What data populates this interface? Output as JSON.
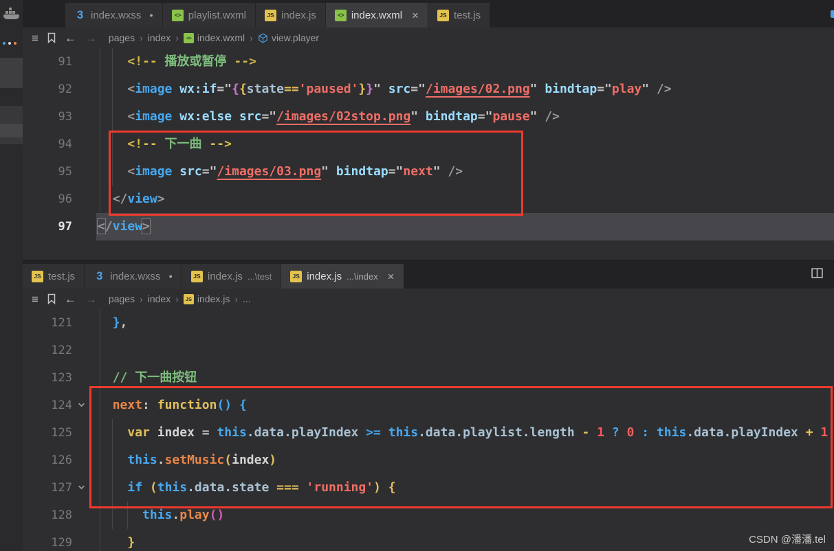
{
  "watermark": "CSDN @潘潘.tel",
  "activity_bar": {
    "icons": [
      "docker-whale-icon",
      "activity-dots"
    ]
  },
  "breadcrumb_lead_icons": [
    "list-icon",
    "bookmark-icon",
    "back-arrow-icon",
    "forward-arrow-icon"
  ],
  "panes": [
    {
      "id": "top",
      "tabs": [
        {
          "label": "index.wxss",
          "icon": "css",
          "modified": true
        },
        {
          "label": "playlist.wxml",
          "icon": "wxml"
        },
        {
          "label": "index.js",
          "icon": "js"
        },
        {
          "label": "index.wxml",
          "icon": "wxml",
          "active": true,
          "close": "×"
        },
        {
          "label": "test.js",
          "icon": "js"
        }
      ],
      "actions": [],
      "breadcrumbs": [
        {
          "label": "pages"
        },
        {
          "label": "index"
        },
        {
          "label": "index.wxml",
          "icon": "wxml"
        },
        {
          "label": "view.player",
          "icon": "symbol"
        }
      ],
      "lines": [
        {
          "num": "91",
          "tokens": [
            [
              "    ",
              "q"
            ],
            [
              "<!--",
              "cp"
            ],
            [
              " 播放或暂停 ",
              "cm"
            ],
            [
              "-->",
              "cp"
            ]
          ]
        },
        {
          "num": "92",
          "tokens": [
            [
              "    ",
              "q"
            ],
            [
              "<",
              "pq"
            ],
            [
              "image",
              "tag"
            ],
            [
              " ",
              "q"
            ],
            [
              "wx:if",
              "attr"
            ],
            [
              "=\"",
              "q"
            ],
            [
              "{",
              "mus"
            ],
            [
              "{",
              "op"
            ],
            [
              "state",
              "prop"
            ],
            [
              "==",
              "op"
            ],
            [
              "'paused'",
              "str"
            ],
            [
              "}",
              "op"
            ],
            [
              "}",
              "mus"
            ],
            [
              "\" ",
              "q"
            ],
            [
              "src",
              "attr"
            ],
            [
              "=\"",
              "q"
            ],
            [
              "/images/02.png",
              "lnk"
            ],
            [
              "\" ",
              "q"
            ],
            [
              "bindtap",
              "attr"
            ],
            [
              "=\"",
              "q"
            ],
            [
              "play",
              "str"
            ],
            [
              "\" ",
              "q"
            ],
            [
              "/>",
              "pq"
            ]
          ]
        },
        {
          "num": "93",
          "tokens": [
            [
              "    ",
              "q"
            ],
            [
              "<",
              "pq"
            ],
            [
              "image",
              "tag"
            ],
            [
              " ",
              "q"
            ],
            [
              "wx:else",
              "attr"
            ],
            [
              " ",
              "q"
            ],
            [
              "src",
              "attr"
            ],
            [
              "=\"",
              "q"
            ],
            [
              "/images/02stop.png",
              "lnk"
            ],
            [
              "\" ",
              "q"
            ],
            [
              "bindtap",
              "attr"
            ],
            [
              "=\"",
              "q"
            ],
            [
              "pause",
              "str"
            ],
            [
              "\" ",
              "q"
            ],
            [
              "/>",
              "pq"
            ]
          ]
        },
        {
          "num": "94",
          "tokens": [
            [
              "    ",
              "q"
            ],
            [
              "<!--",
              "cp"
            ],
            [
              " 下一曲 ",
              "cm"
            ],
            [
              "-->",
              "cp"
            ]
          ]
        },
        {
          "num": "95",
          "tokens": [
            [
              "    ",
              "q"
            ],
            [
              "<",
              "pq"
            ],
            [
              "image",
              "tag"
            ],
            [
              " ",
              "q"
            ],
            [
              "src",
              "attr"
            ],
            [
              "=\"",
              "q"
            ],
            [
              "/images/03.png",
              "lnk"
            ],
            [
              "\" ",
              "q"
            ],
            [
              "bindtap",
              "attr"
            ],
            [
              "=\"",
              "q"
            ],
            [
              "next",
              "str"
            ],
            [
              "\" ",
              "q"
            ],
            [
              "/>",
              "pq"
            ]
          ]
        },
        {
          "num": "96",
          "tokens": [
            [
              "  ",
              "q"
            ],
            [
              "</",
              "pq"
            ],
            [
              "view",
              "tag"
            ],
            [
              ">",
              "pq"
            ]
          ]
        },
        {
          "num": "97",
          "current": true,
          "tokens": [
            [
              "<",
              "pq bm"
            ],
            [
              "/",
              "pq"
            ],
            [
              "view",
              "tag"
            ],
            [
              ">",
              "pq bm"
            ]
          ]
        }
      ]
    },
    {
      "id": "bottom",
      "tabs": [
        {
          "label": "test.js",
          "icon": "js"
        },
        {
          "label": "index.wxss",
          "icon": "css",
          "modified": true
        },
        {
          "label": "index.js",
          "icon": "js",
          "desc": "...\\test"
        },
        {
          "label": "index.js",
          "icon": "js",
          "desc": "...\\index",
          "active": true,
          "close": "×"
        }
      ],
      "actions": [
        "split-editor-icon"
      ],
      "breadcrumbs": [
        {
          "label": "pages"
        },
        {
          "label": "index"
        },
        {
          "label": "index.js",
          "icon": "js"
        },
        {
          "label": "..."
        }
      ],
      "lines": [
        {
          "num": "121",
          "tokens": [
            [
              "  ",
              "q"
            ],
            [
              "}",
              "b1"
            ],
            [
              ",",
              "q"
            ]
          ]
        },
        {
          "num": "122",
          "tokens": []
        },
        {
          "num": "123",
          "tokens": [
            [
              "  ",
              "q"
            ],
            [
              "// 下一曲按钮",
              "cm"
            ]
          ]
        },
        {
          "num": "124",
          "fold": true,
          "tokens": [
            [
              "  ",
              "q"
            ],
            [
              "next",
              "fn"
            ],
            [
              ":",
              "q"
            ],
            [
              " ",
              "q"
            ],
            [
              "function",
              "kw"
            ],
            [
              "(",
              "b1"
            ],
            [
              ")",
              "b1"
            ],
            [
              " ",
              "q"
            ],
            [
              "{",
              "b1"
            ]
          ]
        },
        {
          "num": "125",
          "tokens": [
            [
              "    ",
              "q"
            ],
            [
              "var",
              "kw"
            ],
            [
              " ",
              "q"
            ],
            [
              "index",
              "var"
            ],
            [
              " ",
              "q"
            ],
            [
              "=",
              "q"
            ],
            [
              " ",
              "q"
            ],
            [
              "this",
              "kwb"
            ],
            [
              ".data.playIndex",
              "prop"
            ],
            [
              " ",
              "q"
            ],
            [
              ">=",
              "opb"
            ],
            [
              " ",
              "q"
            ],
            [
              "this",
              "kwb"
            ],
            [
              ".data.playlist.length",
              "prop"
            ],
            [
              " ",
              "q"
            ],
            [
              "-",
              "op"
            ],
            [
              " ",
              "q"
            ],
            [
              "1",
              "num"
            ],
            [
              " ",
              "q"
            ],
            [
              "?",
              "opb"
            ],
            [
              " ",
              "q"
            ],
            [
              "0",
              "num"
            ],
            [
              " ",
              "q"
            ],
            [
              ":",
              "opb"
            ],
            [
              " ",
              "q"
            ],
            [
              "this",
              "kwb"
            ],
            [
              ".data.playIndex",
              "prop"
            ],
            [
              " ",
              "q"
            ],
            [
              "+",
              "op"
            ],
            [
              " ",
              "q"
            ],
            [
              "1",
              "num"
            ]
          ]
        },
        {
          "num": "126",
          "tokens": [
            [
              "    ",
              "q"
            ],
            [
              "this",
              "kwb"
            ],
            [
              ".",
              "q"
            ],
            [
              "setMusic",
              "fn"
            ],
            [
              "(",
              "b2"
            ],
            [
              "index",
              "var"
            ],
            [
              ")",
              "b2"
            ]
          ]
        },
        {
          "num": "127",
          "fold": true,
          "tokens": [
            [
              "    ",
              "q"
            ],
            [
              "if",
              "kwb"
            ],
            [
              " ",
              "q"
            ],
            [
              "(",
              "b2"
            ],
            [
              "this",
              "kwb"
            ],
            [
              ".data.state",
              "prop"
            ],
            [
              " ",
              "q"
            ],
            [
              "===",
              "op"
            ],
            [
              " ",
              "q"
            ],
            [
              "'running'",
              "str"
            ],
            [
              ")",
              "b2"
            ],
            [
              " ",
              "q"
            ],
            [
              "{",
              "b2"
            ]
          ]
        },
        {
          "num": "128",
          "tokens": [
            [
              "      ",
              "q"
            ],
            [
              "this",
              "kwb"
            ],
            [
              ".",
              "q"
            ],
            [
              "play",
              "fn"
            ],
            [
              "(",
              "b3"
            ],
            [
              ")",
              "b3"
            ]
          ]
        },
        {
          "num": "129",
          "tokens": [
            [
              "    ",
              "q"
            ],
            [
              "}",
              "b2"
            ]
          ]
        }
      ]
    }
  ]
}
